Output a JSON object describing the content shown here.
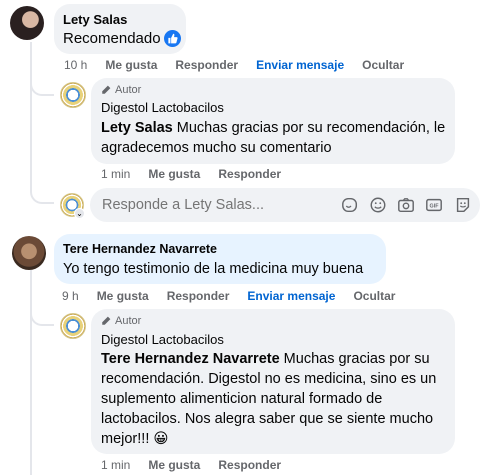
{
  "comments": [
    {
      "author": "Lety Salas",
      "text": "Recomendado",
      "time": "10 h",
      "like": "Me gusta",
      "reply": "Responder",
      "message": "Enviar mensaje",
      "hide": "Ocultar",
      "reply_item": {
        "badge": "Autor",
        "author": "Digestol Lactobacilos",
        "mention": "Lety Salas",
        "text": " Muchas gracias por su recomendación, le agradecemos mucho su comentario",
        "time": "1 min",
        "like": "Me gusta",
        "reply": "Responder"
      },
      "reply_box": {
        "placeholder": "Responde a Lety Salas..."
      }
    },
    {
      "author": "Tere Hernandez Navarrete",
      "text": "Yo tengo testimonio de la medicina muy buena",
      "time": "9 h",
      "like": "Me gusta",
      "reply": "Responder",
      "message": "Enviar mensaje",
      "hide": "Ocultar",
      "reply_item": {
        "badge": "Autor",
        "author": "Digestol Lactobacilos",
        "mention": "Tere Hernandez Navarrete",
        "text": " Muchas gracias por su recomendación. Digestol no es medicina, sino es un suplemento alimenticion natural formado de lactobacilos. Nos alegra saber que se siente mucho mejor!!! 😀",
        "time": "1 min",
        "like": "Me gusta",
        "reply": "Responder"
      }
    }
  ],
  "icons": {
    "like_badge": "thumbs-up-icon",
    "author_badge": "pen-icon",
    "composer": [
      "sticker-icon",
      "emoji-icon",
      "camera-icon",
      "gif-icon",
      "avatar-sticker-icon"
    ]
  },
  "colors": {
    "link_blue": "#0064d1",
    "like_blue": "#1877f2",
    "bubble_gray": "#f0f2f5",
    "tere_bubble": "#e7f3ff"
  }
}
